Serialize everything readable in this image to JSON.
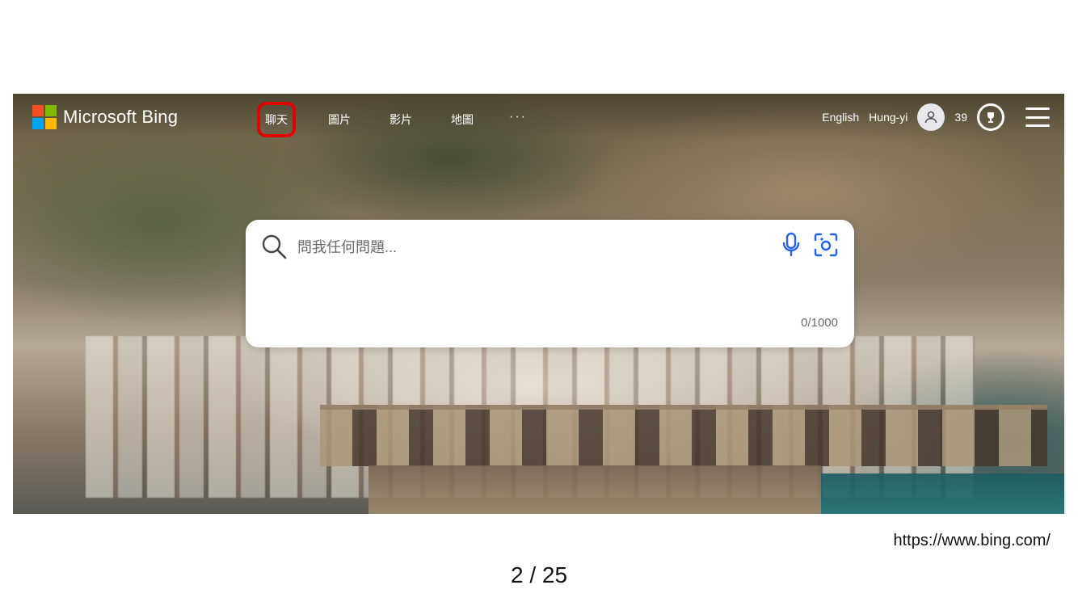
{
  "brand": {
    "name": "Microsoft Bing",
    "logo_colors": [
      "#f25022",
      "#7fba00",
      "#00a4ef",
      "#ffb900"
    ]
  },
  "nav": {
    "items": [
      {
        "label": "聊天",
        "active": true
      },
      {
        "label": "圖片",
        "active": false
      },
      {
        "label": "影片",
        "active": false
      },
      {
        "label": "地圖",
        "active": false
      }
    ],
    "more_label": "···"
  },
  "header_right": {
    "language": "English",
    "user_name": "Hung-yi",
    "rewards_points": "39"
  },
  "search": {
    "placeholder": "問我任何問題...",
    "value": "",
    "char_count": "0/1000",
    "icons": [
      "search-icon",
      "microphone-icon",
      "visual-search-icon"
    ]
  },
  "footer": {
    "url": "https://www.bing.com/",
    "page_indicator": "2 / 25"
  },
  "colors": {
    "accent": "#2563eb",
    "highlight_box": "#e00000"
  }
}
